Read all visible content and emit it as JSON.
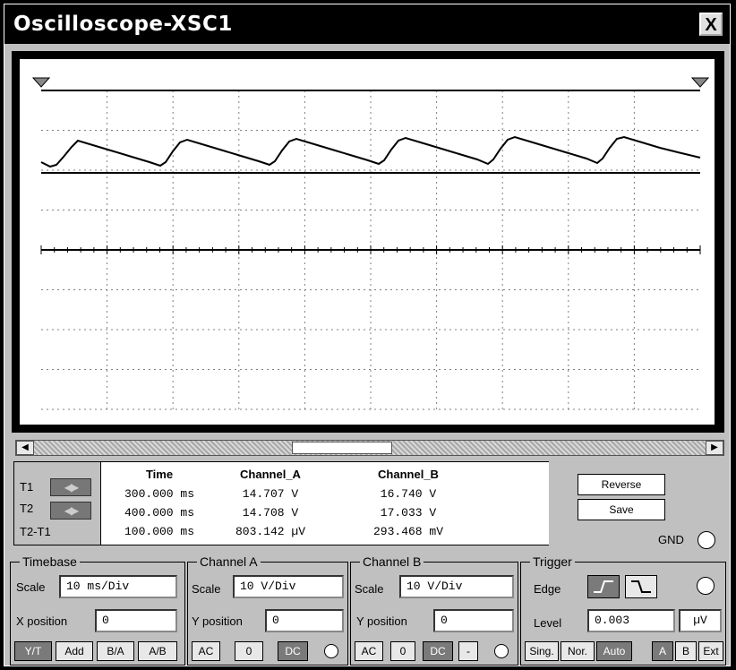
{
  "window": {
    "title": "Oscilloscope-XSC1",
    "close_label": "X"
  },
  "readout": {
    "t1_label": "T1",
    "t2_label": "T2",
    "t2t1_label": "T2-T1",
    "headers": [
      "Time",
      "Channel_A",
      "Channel_B"
    ],
    "rows": [
      [
        "300.000 ms",
        "14.707 V",
        "16.740 V"
      ],
      [
        "400.000 ms",
        "14.708 V",
        "17.033 V"
      ],
      [
        "100.000 ms",
        "803.142 µV",
        "293.468 mV"
      ]
    ]
  },
  "buttons": {
    "reverse": "Reverse",
    "save": "Save",
    "gnd": "GND"
  },
  "timebase": {
    "title": "Timebase",
    "scale_label": "Scale",
    "scale_value": "10 ms/Div",
    "xpos_label": "X position",
    "xpos_value": "0",
    "modes": [
      "Y/T",
      "Add",
      "B/A",
      "A/B"
    ]
  },
  "channel_a": {
    "title": "Channel A",
    "scale_label": "Scale",
    "scale_value": "10  V/Div",
    "ypos_label": "Y position",
    "ypos_value": "0",
    "coupling": [
      "AC",
      "0",
      "DC"
    ]
  },
  "channel_b": {
    "title": "Channel B",
    "scale_label": "Scale",
    "scale_value": "10  V/Div",
    "ypos_label": "Y position",
    "ypos_value": "0",
    "coupling": [
      "AC",
      "0",
      "DC",
      "-"
    ]
  },
  "trigger": {
    "title": "Trigger",
    "edge_label": "Edge",
    "level_label": "Level",
    "level_value": "0.003",
    "level_unit": "µV",
    "modes": [
      "Sing.",
      "Nor.",
      "Auto"
    ],
    "sources": [
      "A",
      "B",
      "Ext"
    ]
  },
  "colors": {
    "trace": "#000000",
    "grid": "#808080"
  }
}
